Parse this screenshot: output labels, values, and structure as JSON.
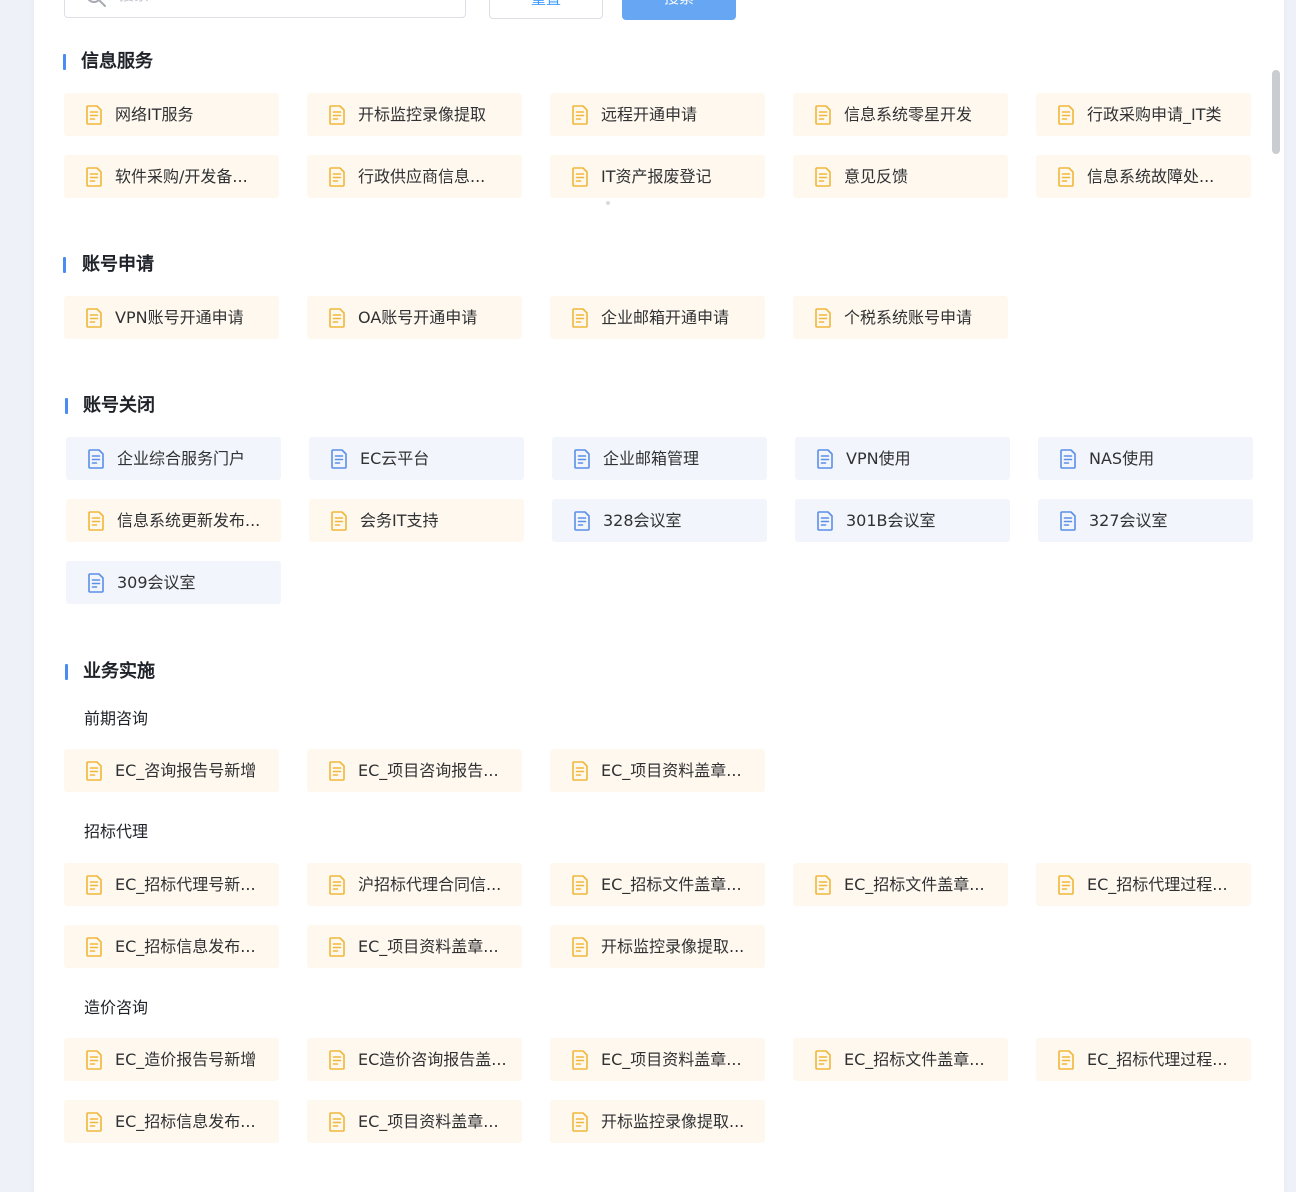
{
  "toolbar": {
    "search_placeholder": "搜索",
    "reset_label": "重置",
    "search_label": "搜索"
  },
  "sections": [
    {
      "title": "信息服务",
      "groups": [
        {
          "subtitle": "",
          "items": [
            {
              "label": "网络IT服务",
              "tone": "warm"
            },
            {
              "label": "开标监控录像提取",
              "tone": "warm"
            },
            {
              "label": "远程开通申请",
              "tone": "warm"
            },
            {
              "label": "信息系统零星开发",
              "tone": "warm"
            },
            {
              "label": "行政采购申请_IT类",
              "tone": "warm"
            },
            {
              "label": "软件采购/开发备...",
              "tone": "warm"
            },
            {
              "label": "行政供应商信息...",
              "tone": "warm"
            },
            {
              "label": "IT资产报废登记",
              "tone": "warm"
            },
            {
              "label": "意见反馈",
              "tone": "warm"
            },
            {
              "label": "信息系统故障处...",
              "tone": "warm"
            }
          ]
        }
      ]
    },
    {
      "title": "账号申请",
      "groups": [
        {
          "subtitle": "",
          "items": [
            {
              "label": "VPN账号开通申请",
              "tone": "warm"
            },
            {
              "label": "OA账号开通申请",
              "tone": "warm"
            },
            {
              "label": "企业邮箱开通申请",
              "tone": "warm"
            },
            {
              "label": "个税系统账号申请",
              "tone": "warm"
            }
          ]
        }
      ]
    },
    {
      "title": "账号关闭",
      "groups": [
        {
          "subtitle": "",
          "items": [
            {
              "label": "企业综合服务门户",
              "tone": "cool"
            },
            {
              "label": "EC云平台",
              "tone": "cool"
            },
            {
              "label": "企业邮箱管理",
              "tone": "cool"
            },
            {
              "label": "VPN使用",
              "tone": "cool"
            },
            {
              "label": "NAS使用",
              "tone": "cool"
            },
            {
              "label": "信息系统更新发布...",
              "tone": "warm"
            },
            {
              "label": "会务IT支持",
              "tone": "warm"
            },
            {
              "label": "328会议室",
              "tone": "cool"
            },
            {
              "label": "301B会议室",
              "tone": "cool"
            },
            {
              "label": "327会议室",
              "tone": "cool"
            },
            {
              "label": "309会议室",
              "tone": "cool"
            }
          ]
        }
      ]
    },
    {
      "title": "业务实施",
      "groups": [
        {
          "subtitle": "前期咨询",
          "items": [
            {
              "label": "EC_咨询报告号新增",
              "tone": "warm"
            },
            {
              "label": "EC_项目咨询报告...",
              "tone": "warm"
            },
            {
              "label": "EC_项目资料盖章...",
              "tone": "warm"
            }
          ]
        },
        {
          "subtitle": "招标代理",
          "items": [
            {
              "label": "EC_招标代理号新...",
              "tone": "warm"
            },
            {
              "label": "沪招标代理合同信...",
              "tone": "warm"
            },
            {
              "label": "EC_招标文件盖章...",
              "tone": "warm"
            },
            {
              "label": "EC_招标文件盖章...",
              "tone": "warm"
            },
            {
              "label": "EC_招标代理过程...",
              "tone": "warm"
            },
            {
              "label": "EC_招标信息发布...",
              "tone": "warm"
            },
            {
              "label": "EC_项目资料盖章...",
              "tone": "warm"
            },
            {
              "label": "开标监控录像提取...",
              "tone": "warm"
            }
          ]
        },
        {
          "subtitle": "造价咨询",
          "items": [
            {
              "label": "EC_造价报告号新增",
              "tone": "warm"
            },
            {
              "label": "EC造价咨询报告盖...",
              "tone": "warm"
            },
            {
              "label": "EC_项目资料盖章...",
              "tone": "warm"
            },
            {
              "label": "EC_招标文件盖章...",
              "tone": "warm"
            },
            {
              "label": "EC_招标代理过程...",
              "tone": "warm"
            },
            {
              "label": "EC_招标信息发布...",
              "tone": "warm"
            },
            {
              "label": "EC_项目资料盖章...",
              "tone": "warm"
            },
            {
              "label": "开标监控录像提取...",
              "tone": "warm"
            }
          ]
        }
      ]
    }
  ],
  "colors": {
    "warm_bg": "#fef8ef",
    "warm_icon": "#f0b73a",
    "cool_bg": "#f2f5fb",
    "cool_icon": "#5b8fe8",
    "accent": "#4b8cf2"
  },
  "icons": {
    "search": "search-icon",
    "card": "form-document-icon"
  }
}
